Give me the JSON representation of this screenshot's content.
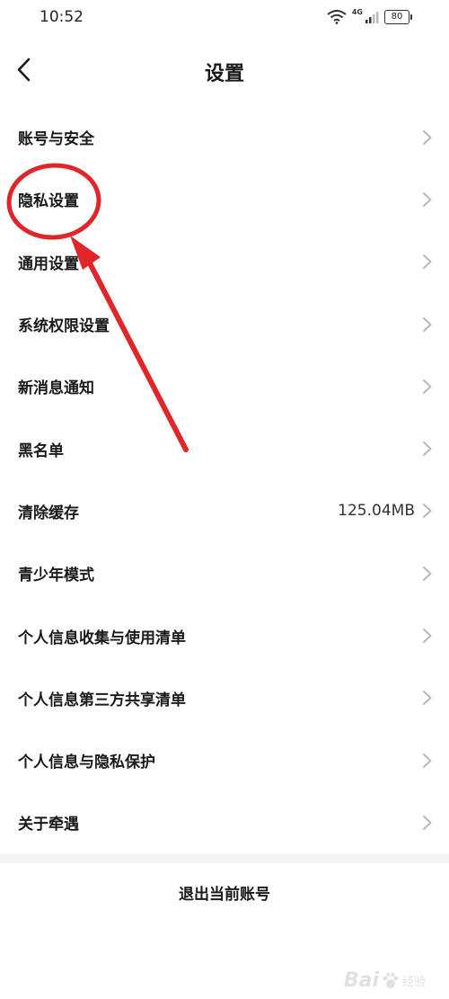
{
  "status_bar": {
    "time": "10:52",
    "network": "4G",
    "battery": "80"
  },
  "header": {
    "title": "设置",
    "back_icon": "chevron-left-icon"
  },
  "settings": {
    "items": [
      {
        "label": "账号与安全"
      },
      {
        "label": "隐私设置"
      },
      {
        "label": "通用设置"
      },
      {
        "label": "系统权限设置"
      },
      {
        "label": "新消息通知"
      },
      {
        "label": "黑名单"
      },
      {
        "label": "清除缓存",
        "value": "125.04MB"
      },
      {
        "label": "青少年模式"
      },
      {
        "label": "个人信息收集与使用清单"
      },
      {
        "label": "个人信息第三方共享清单"
      },
      {
        "label": "个人信息与隐私保护"
      },
      {
        "label": "关于牵遇"
      }
    ]
  },
  "footer": {
    "logout_label": "退出当前账号"
  },
  "annotation": {
    "color": "#e0262a",
    "shapes": [
      "circle",
      "arrow"
    ]
  },
  "watermark": {
    "brand": "Bai",
    "sub": "经验"
  },
  "colors": {
    "background": "#ffffff",
    "divider": "#f4f4f6",
    "chevron": "#b8b8b8"
  }
}
